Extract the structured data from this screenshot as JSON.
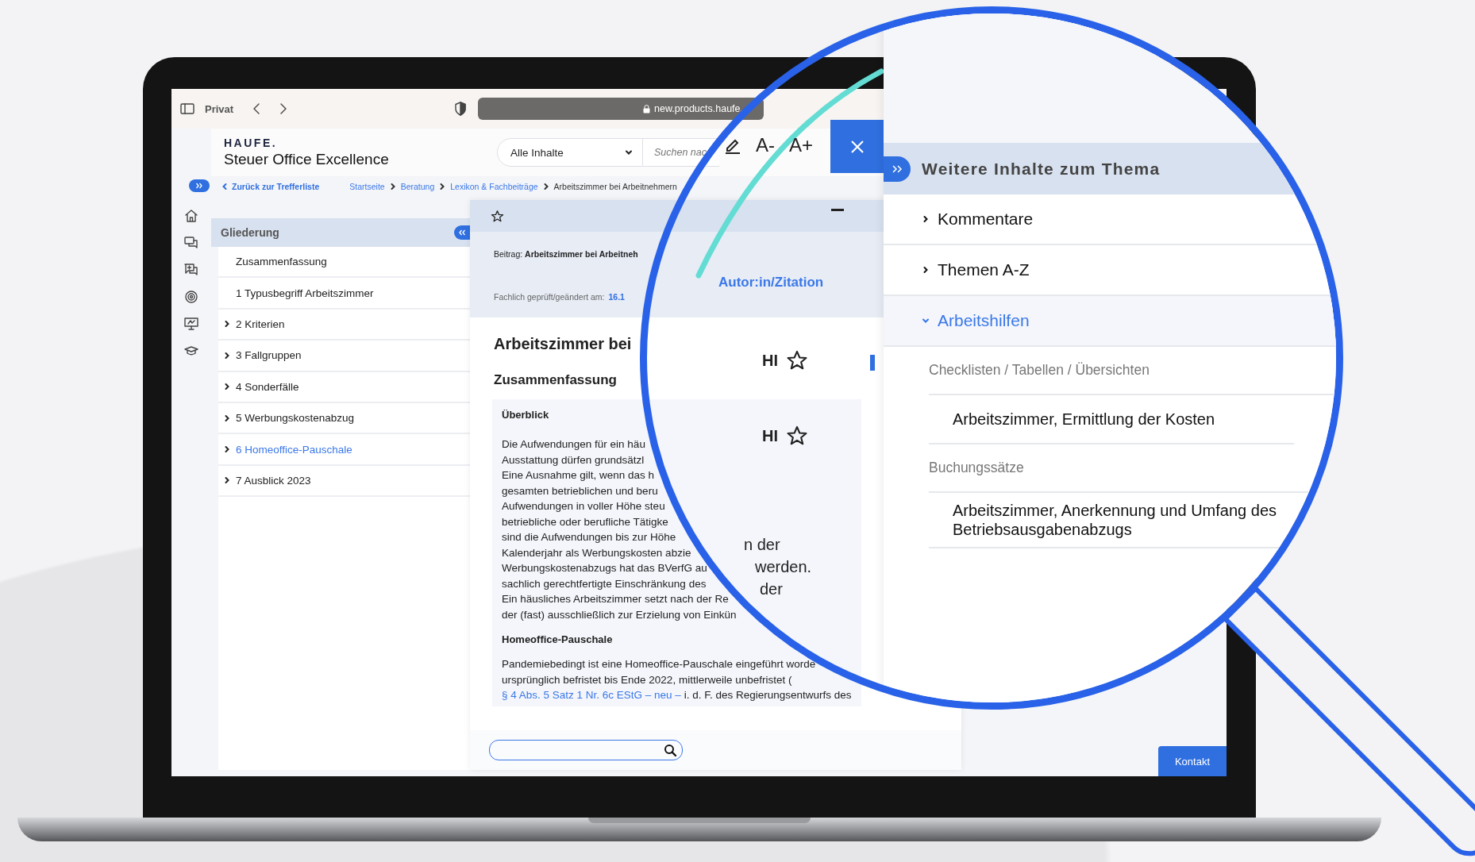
{
  "browser": {
    "profile": "Privat",
    "url": "new.products.haufe."
  },
  "app": {
    "logo": "HAUFE.",
    "product": "Steuer Office Excellence"
  },
  "search": {
    "scope": "Alle Inhalte",
    "placeholder": "Suchen nac"
  },
  "breadcrumb": {
    "back": "Zurück zur Trefferliste",
    "items": [
      "Startseite",
      "Beratung",
      "Lexikon & Fachbeiträge",
      "Arbeitszimmer bei Arbeitnehmern"
    ]
  },
  "outline": {
    "title": "Gliederung",
    "items": [
      {
        "label": "Zusammenfassung",
        "expandable": false,
        "selected": false
      },
      {
        "label": "1 Typusbegriff Arbeitszimmer",
        "expandable": false,
        "selected": false
      },
      {
        "label": "2 Kriterien",
        "expandable": true,
        "selected": false
      },
      {
        "label": "3 Fallgruppen",
        "expandable": true,
        "selected": false
      },
      {
        "label": "4 Sonderfälle",
        "expandable": true,
        "selected": false
      },
      {
        "label": "5 Werbungskostenabzug",
        "expandable": true,
        "selected": false
      },
      {
        "label": "6 Homeoffice-Pauschale",
        "expandable": true,
        "selected": true
      },
      {
        "label": "7 Ausblick 2023",
        "expandable": true,
        "selected": false
      }
    ]
  },
  "article": {
    "beitrag": "Beitrag: **Arbeitszimmer bei Arbeitneh**",
    "checked_label": "Fachlich geprüft/geändert am:",
    "checked_date": "16.1",
    "title": "Arbeitszimmer bei",
    "summary_heading": "Zusammenfassung",
    "box_title": "Überblick",
    "overview_lines": [
      "Die Aufwendungen für ein häu",
      "Ausstattung dürfen grundsätzl",
      "Eine Ausnahme gilt, wenn das h",
      "gesamten betrieblichen und beru",
      "Aufwendungen in voller Höhe steu",
      "betriebliche oder berufliche Tätigke",
      "sind die Aufwendungen bis zur Höhe",
      "Kalenderjahr als Werbungskosten abzie",
      "Werbungskostenabzugs hat das BVerfG au",
      "sachlich gerechtfertigte Einschränkung des",
      "Ein häusliches Arbeitszimmer setzt nach der Re",
      "der (fast) ausschließlich zur Erzielung von Einkün"
    ],
    "subheading": "Homeoffice-Pauschale",
    "pauschale_lines": [
      "Pandemiebedingt ist eine Homeoffice-Pauschale eingeführt worde",
      "ursprünglich befristet bis Ende 2022, mittlerweile unbefristet ("
    ],
    "reference_link": "§ 4 Abs. 5 Satz 1 Nr. 6c EStG – neu –",
    "reference_rest": "i. d. F. des Regierungsentwurfs des"
  },
  "magnifier": {
    "font_smaller": "A-",
    "font_larger": "A+",
    "author_link": "Autor:in/Zitation",
    "marks": [
      "HI",
      "HI"
    ],
    "fragments": [
      "n der",
      "werden.",
      "der"
    ],
    "related": {
      "title": "Weitere Inhalte zum Thema",
      "sections": [
        {
          "label": "Kommentare",
          "expanded": false
        },
        {
          "label": "Themen A-Z",
          "expanded": false
        },
        {
          "label": "Arbeitshilfen",
          "expanded": true,
          "children": [
            {
              "kind": "group",
              "label": "Checklisten / Tabellen / Übersichten"
            },
            {
              "kind": "link",
              "label": "Arbeitszimmer, Ermittlung der Kosten"
            },
            {
              "kind": "group",
              "label": "Buchungssätze"
            },
            {
              "kind": "link",
              "label": "Arbeitszimmer, Anerkennung und Umfang des Betriebsausgabenabzugs"
            }
          ]
        }
      ]
    }
  },
  "contact": "Kontakt"
}
